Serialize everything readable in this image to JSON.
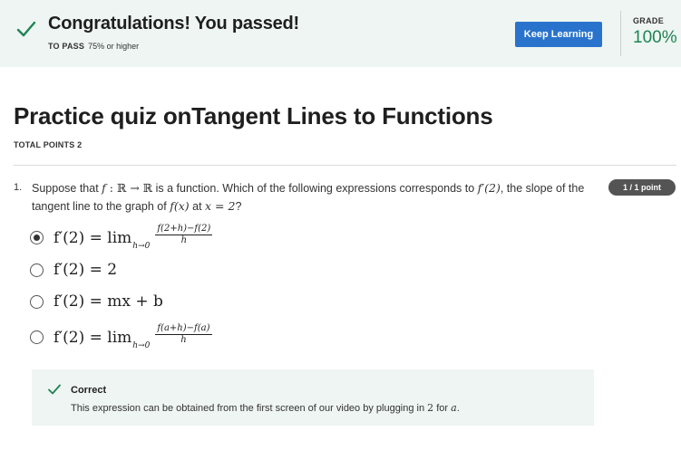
{
  "banner": {
    "title": "Congratulations! You passed!",
    "to_pass_label": "TO PASS",
    "to_pass_value": "75% or higher",
    "keep_learning_label": "Keep Learning",
    "grade_label": "GRADE",
    "grade_value": "100%"
  },
  "quiz": {
    "title": "Practice quiz onTangent Lines to Functions",
    "total_points": "TOTAL POINTS 2"
  },
  "question": {
    "number": "1.",
    "text_1": "Suppose that ",
    "math_f": "f",
    "math_map": " : ℝ → ℝ",
    "text_2": " is a function. Which of the following expressions corresponds to ",
    "math_fp2": "f′(2)",
    "text_3": ", the slope of the tangent line to the graph of ",
    "math_fx": "f(x)",
    "text_4": " at ",
    "math_x2": "x = 2",
    "text_5": "?",
    "points_badge": "1 / 1 point",
    "options": [
      {
        "checked": true,
        "lhs": "f′(2) = lim",
        "sub": "h→0",
        "num": "f(2+h)−f(2)",
        "den": "h"
      },
      {
        "checked": false,
        "lhs": "f′(2) = 2"
      },
      {
        "checked": false,
        "lhs": "f′(2) = mx + b"
      },
      {
        "checked": false,
        "lhs": "f′(2) = lim",
        "sub": "h→0",
        "num": "f(a+h)−f(a)",
        "den": "h"
      }
    ]
  },
  "feedback": {
    "title": "Correct",
    "text_1": "This expression can be obtained from the first screen of our video by plugging in ",
    "math_2": "2",
    "text_2": " for ",
    "math_a": "a",
    "text_3": "."
  },
  "colors": {
    "banner_bg": "#eef5f2",
    "accent_green": "#1f8354",
    "button_blue": "#2a73cc",
    "badge_gray": "#545454"
  },
  "icons": {
    "banner_check": "check-icon",
    "feedback_check": "check-icon"
  }
}
